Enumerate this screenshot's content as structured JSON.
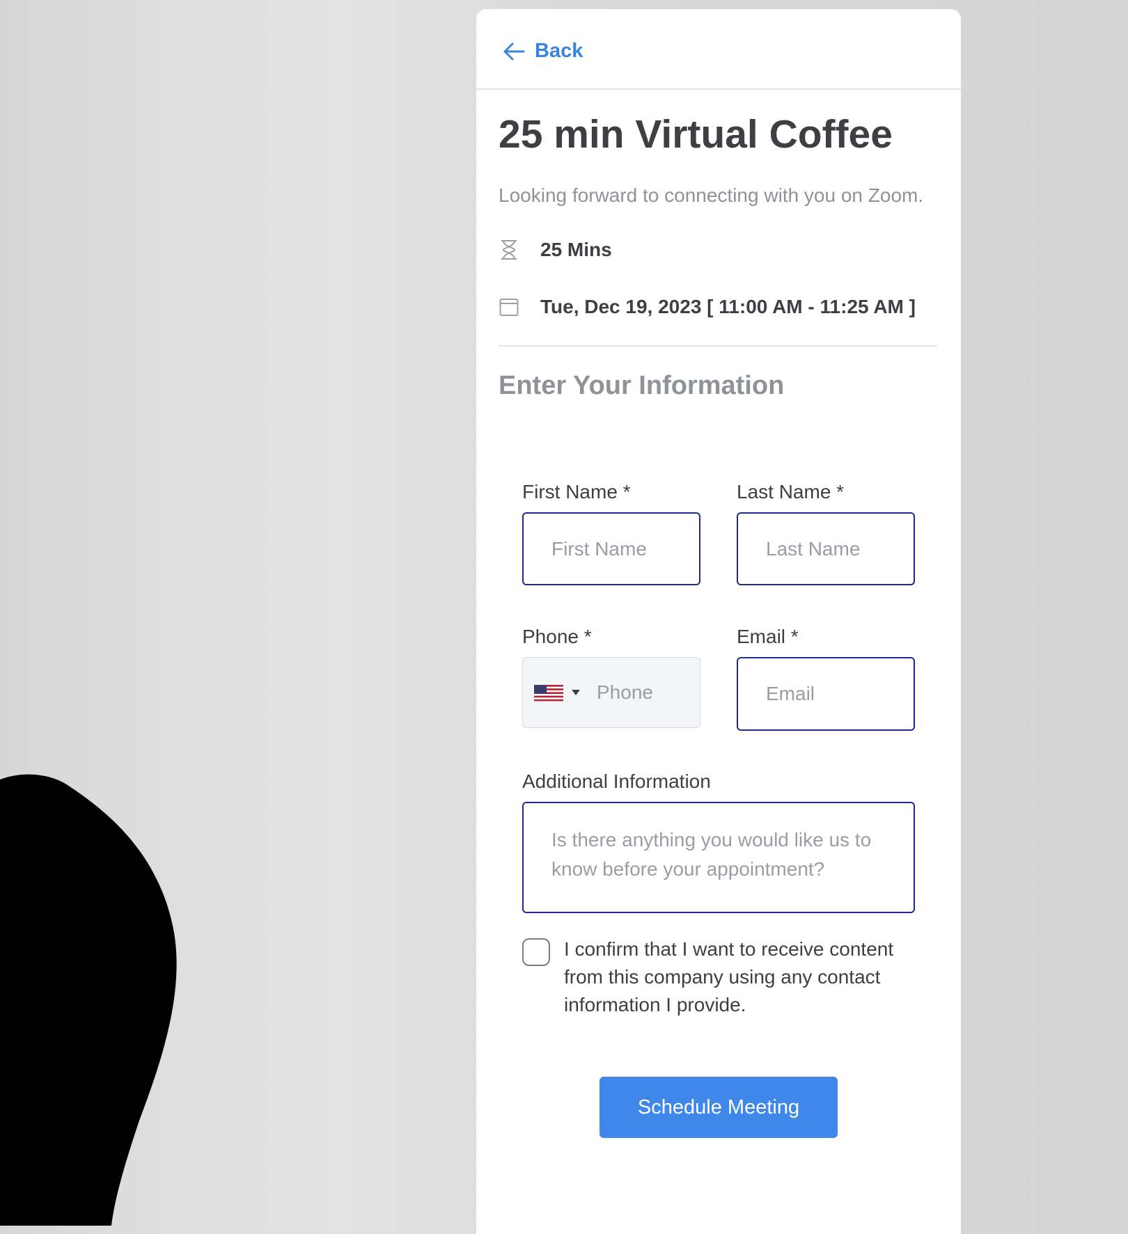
{
  "header": {
    "back_label": "Back"
  },
  "event": {
    "title": "25 min Virtual Coffee",
    "description": "Looking forward to connecting with you on Zoom.",
    "duration": "25 Mins",
    "datetime": "Tue, Dec 19, 2023 [ 11:00 AM - 11:25 AM ]"
  },
  "form": {
    "section_title": "Enter Your Information",
    "first_name": {
      "label": "First Name *",
      "placeholder": "First Name"
    },
    "last_name": {
      "label": "Last Name *",
      "placeholder": "Last Name"
    },
    "phone": {
      "label": "Phone *",
      "placeholder": "Phone",
      "country_icon": "us-flag-icon"
    },
    "email": {
      "label": "Email *",
      "placeholder": "Email"
    },
    "additional": {
      "label": "Additional Information",
      "placeholder": "Is there anything you would like us to know before your appointment?"
    },
    "consent_text": "I confirm that I want to receive content from this company using any contact information I provide.",
    "consent_checked": false,
    "submit_label": "Schedule Meeting"
  },
  "colors": {
    "accent": "#3f87e8",
    "input_border": "#1e2a8c",
    "title": "#3d3f42",
    "muted": "#8f9296"
  }
}
